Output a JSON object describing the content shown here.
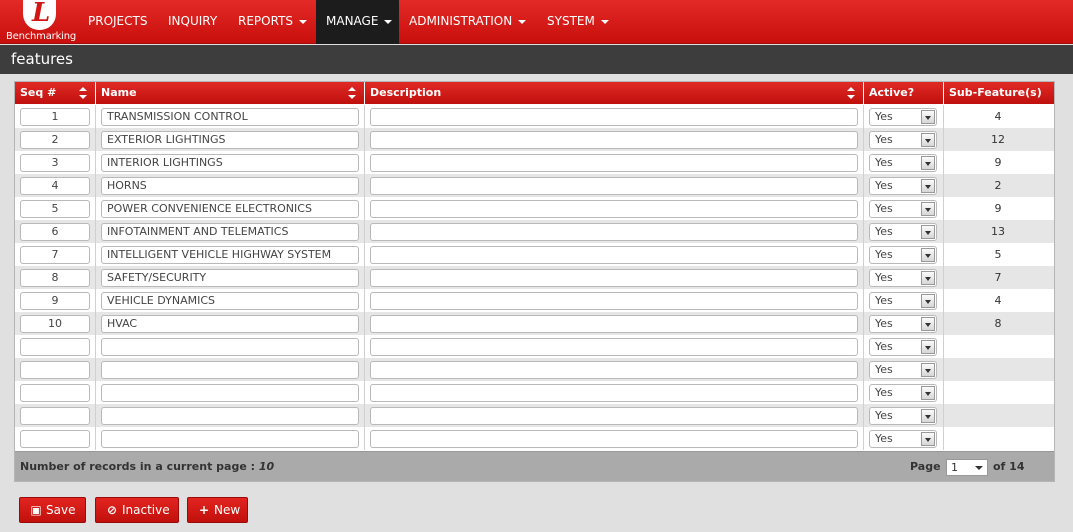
{
  "app": {
    "logo_letter": "L",
    "logo_text": "Benchmarking"
  },
  "nav": [
    {
      "label": "PROJECTS",
      "dropdown": false,
      "active": false
    },
    {
      "label": "INQUIRY",
      "dropdown": false,
      "active": false
    },
    {
      "label": "REPORTS",
      "dropdown": true,
      "active": false
    },
    {
      "label": "MANAGE",
      "dropdown": true,
      "active": true
    },
    {
      "label": "ADMINISTRATION",
      "dropdown": true,
      "active": false
    },
    {
      "label": "SYSTEM",
      "dropdown": true,
      "active": false
    }
  ],
  "page": {
    "title": "features"
  },
  "grid": {
    "columns": [
      "Seq #",
      "Name",
      "Description",
      "Active?",
      "Sub-Feature(s)"
    ],
    "rows": [
      {
        "seq": "1",
        "name": "TRANSMISSION CONTROL",
        "description": "",
        "active": "Yes",
        "sub": "4"
      },
      {
        "seq": "2",
        "name": "EXTERIOR LIGHTINGS",
        "description": "",
        "active": "Yes",
        "sub": "12"
      },
      {
        "seq": "3",
        "name": "INTERIOR LIGHTINGS",
        "description": "",
        "active": "Yes",
        "sub": "9"
      },
      {
        "seq": "4",
        "name": "HORNS",
        "description": "",
        "active": "Yes",
        "sub": "2"
      },
      {
        "seq": "5",
        "name": "POWER CONVENIENCE ELECTRONICS",
        "description": "",
        "active": "Yes",
        "sub": "9"
      },
      {
        "seq": "6",
        "name": "INFOTAINMENT AND TELEMATICS",
        "description": "",
        "active": "Yes",
        "sub": "13"
      },
      {
        "seq": "7",
        "name": "INTELLIGENT VEHICLE HIGHWAY SYSTEM",
        "description": "",
        "active": "Yes",
        "sub": "5"
      },
      {
        "seq": "8",
        "name": "SAFETY/SECURITY",
        "description": "",
        "active": "Yes",
        "sub": "7"
      },
      {
        "seq": "9",
        "name": "VEHICLE DYNAMICS",
        "description": "",
        "active": "Yes",
        "sub": "4"
      },
      {
        "seq": "10",
        "name": "HVAC",
        "description": "",
        "active": "Yes",
        "sub": "8"
      },
      {
        "seq": "",
        "name": "",
        "description": "",
        "active": "Yes",
        "sub": ""
      },
      {
        "seq": "",
        "name": "",
        "description": "",
        "active": "Yes",
        "sub": ""
      },
      {
        "seq": "",
        "name": "",
        "description": "",
        "active": "Yes",
        "sub": ""
      },
      {
        "seq": "",
        "name": "",
        "description": "",
        "active": "Yes",
        "sub": ""
      },
      {
        "seq": "",
        "name": "",
        "description": "",
        "active": "Yes",
        "sub": ""
      }
    ]
  },
  "footer": {
    "records_label": "Number of records in a current page : ",
    "records_count": "10",
    "page_label": "Page",
    "page_value": "1",
    "page_of": "of 14"
  },
  "actions": {
    "save": {
      "label": "Save",
      "icon": "floppy-icon"
    },
    "inactive": {
      "label": "Inactive",
      "icon": "ban-icon"
    },
    "new": {
      "label": "New",
      "icon": "plus-icon"
    }
  },
  "colors": {
    "accent": "#d11614",
    "dark": "#3d3d3d",
    "active_nav": "#1c1c1c"
  }
}
